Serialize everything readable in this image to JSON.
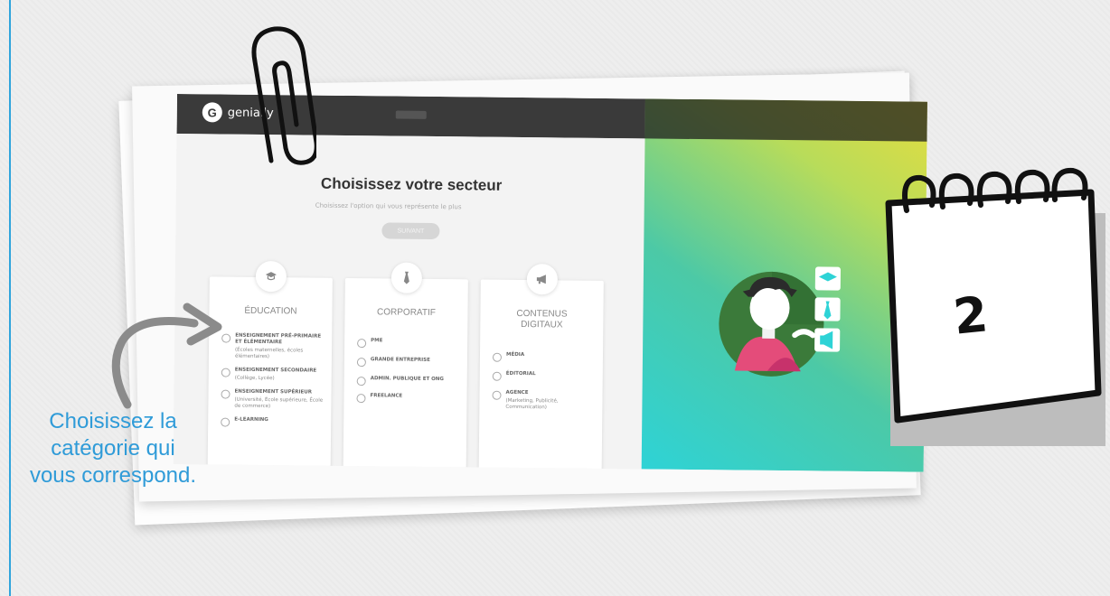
{
  "app": {
    "logo_letter": "G",
    "logo_text": "genially"
  },
  "sector_page": {
    "title": "Choisissez votre secteur",
    "subtitle": "Choisissez l'option qui vous représente le plus",
    "next_button": "SUIVANT"
  },
  "cards": [
    {
      "icon": "graduation-cap-icon",
      "title": "ÉDUCATION",
      "options": [
        {
          "label": "ENSEIGNEMENT PRÉ-PRIMAIRE ET ÉLÉMENTAIRE",
          "sub": "(Écoles maternelles, écoles élémentaires)"
        },
        {
          "label": "ENSEIGNEMENT SECONDAIRE",
          "sub": "(Collège, Lycée)"
        },
        {
          "label": "ENSEIGNEMENT SUPÉRIEUR",
          "sub": "(Université, École supérieure, École de commerce)"
        },
        {
          "label": "E-LEARNING",
          "sub": ""
        }
      ]
    },
    {
      "icon": "tie-icon",
      "title": "CORPORATIF",
      "options": [
        {
          "label": "PME",
          "sub": ""
        },
        {
          "label": "GRANDE ENTREPRISE",
          "sub": ""
        },
        {
          "label": "ADMIN. PUBLIQUE ET ONG",
          "sub": ""
        },
        {
          "label": "FREELANCE",
          "sub": ""
        }
      ]
    },
    {
      "icon": "megaphone-icon",
      "title": "CONTENUS DIGITAUX",
      "options": [
        {
          "label": "MÉDIA",
          "sub": ""
        },
        {
          "label": "ÉDITORIAL",
          "sub": ""
        },
        {
          "label": "AGENCE",
          "sub": "(Marketing, Publicité, Communication)"
        }
      ]
    }
  ],
  "calendar": {
    "number": "2"
  },
  "hint": {
    "text": "Choisissez la catégorie qui vous correspond."
  },
  "colors": {
    "accent": "#2f9bd8",
    "topbar": "#3a3a3a"
  }
}
